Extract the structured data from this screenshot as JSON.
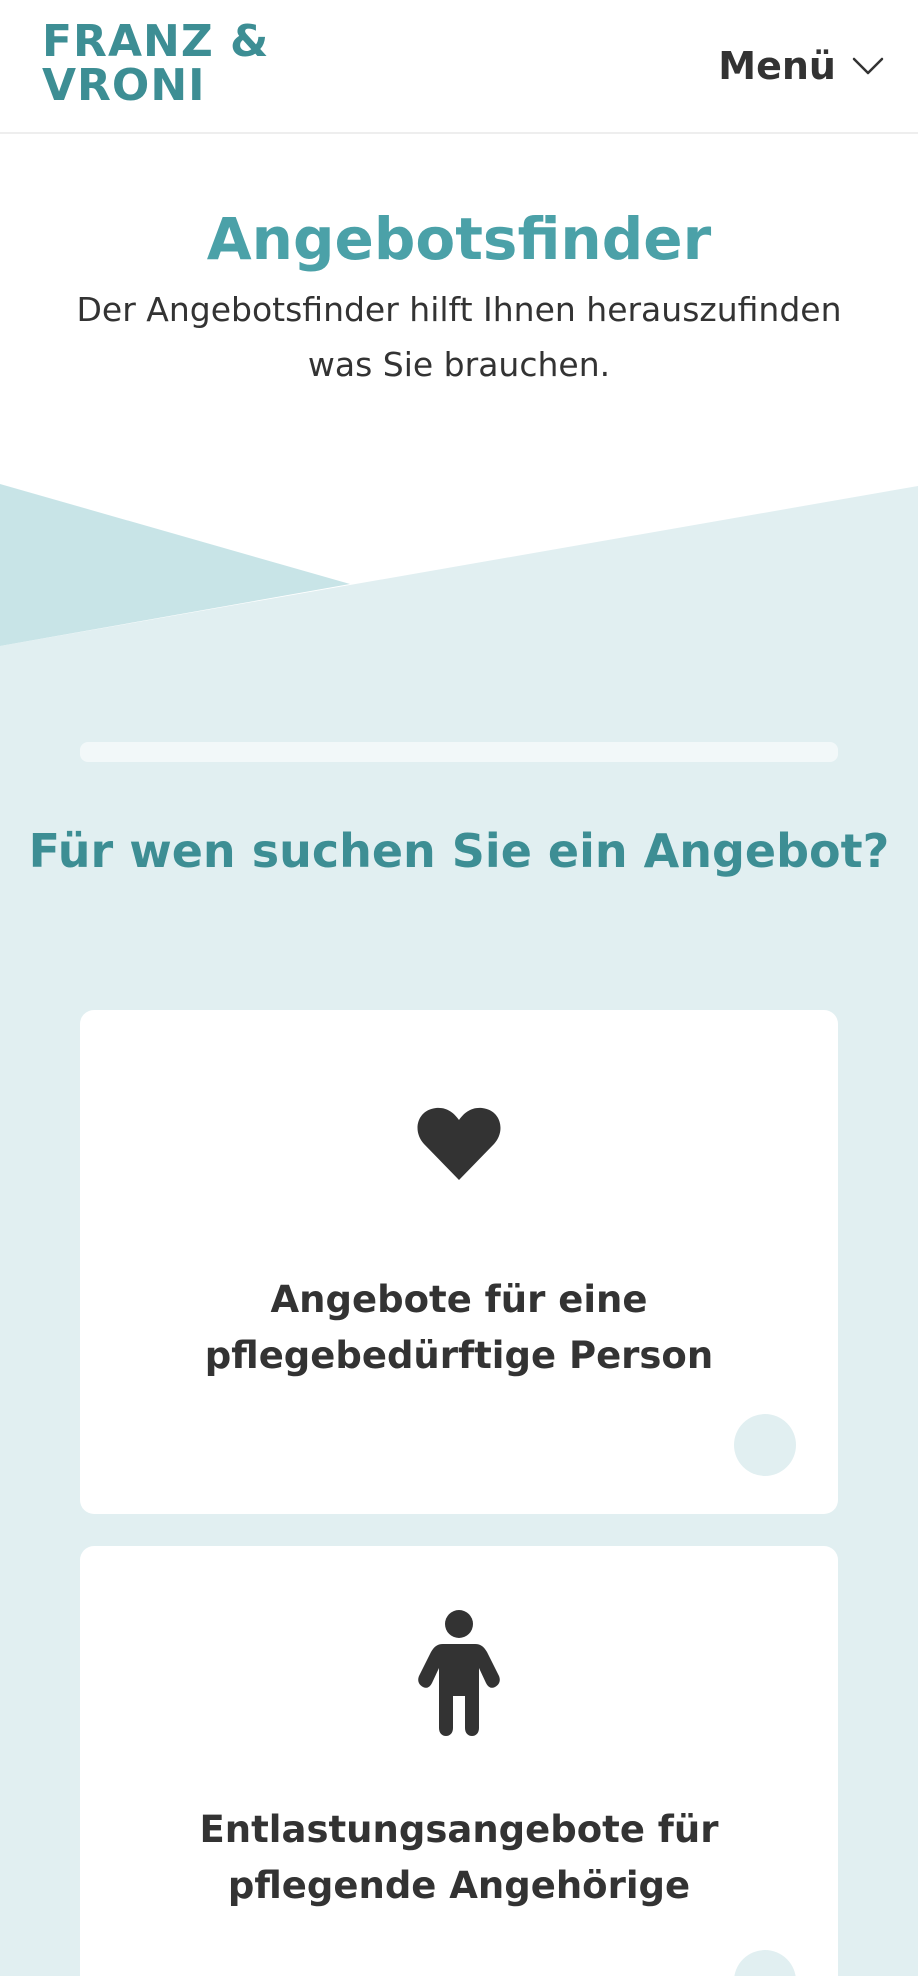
{
  "header": {
    "logo_line1": "FRANZ &",
    "logo_line2": "VRONI",
    "menu_label": "Menü",
    "menu_icon": "chevron-down-icon"
  },
  "intro": {
    "title": "Angebotsfinder",
    "text": "Der Angebotsfinder hilft Ihnen herauszufinden was Sie brauchen."
  },
  "finder": {
    "progress_percent": 0,
    "question": "Für wen suchen Sie ein Angebot?",
    "options": [
      {
        "icon": "heart-icon",
        "label": "Angebote für eine pflegebedürftige Person"
      },
      {
        "icon": "person-icon",
        "label": "Entlastungsangebote für pflegende Angehörige"
      }
    ]
  },
  "colors": {
    "brand": "#3d8e94",
    "accent": "#4ba1a8",
    "section_bg": "#e1eff1",
    "wedge_dark": "#c8e4e7",
    "text": "#333333"
  }
}
